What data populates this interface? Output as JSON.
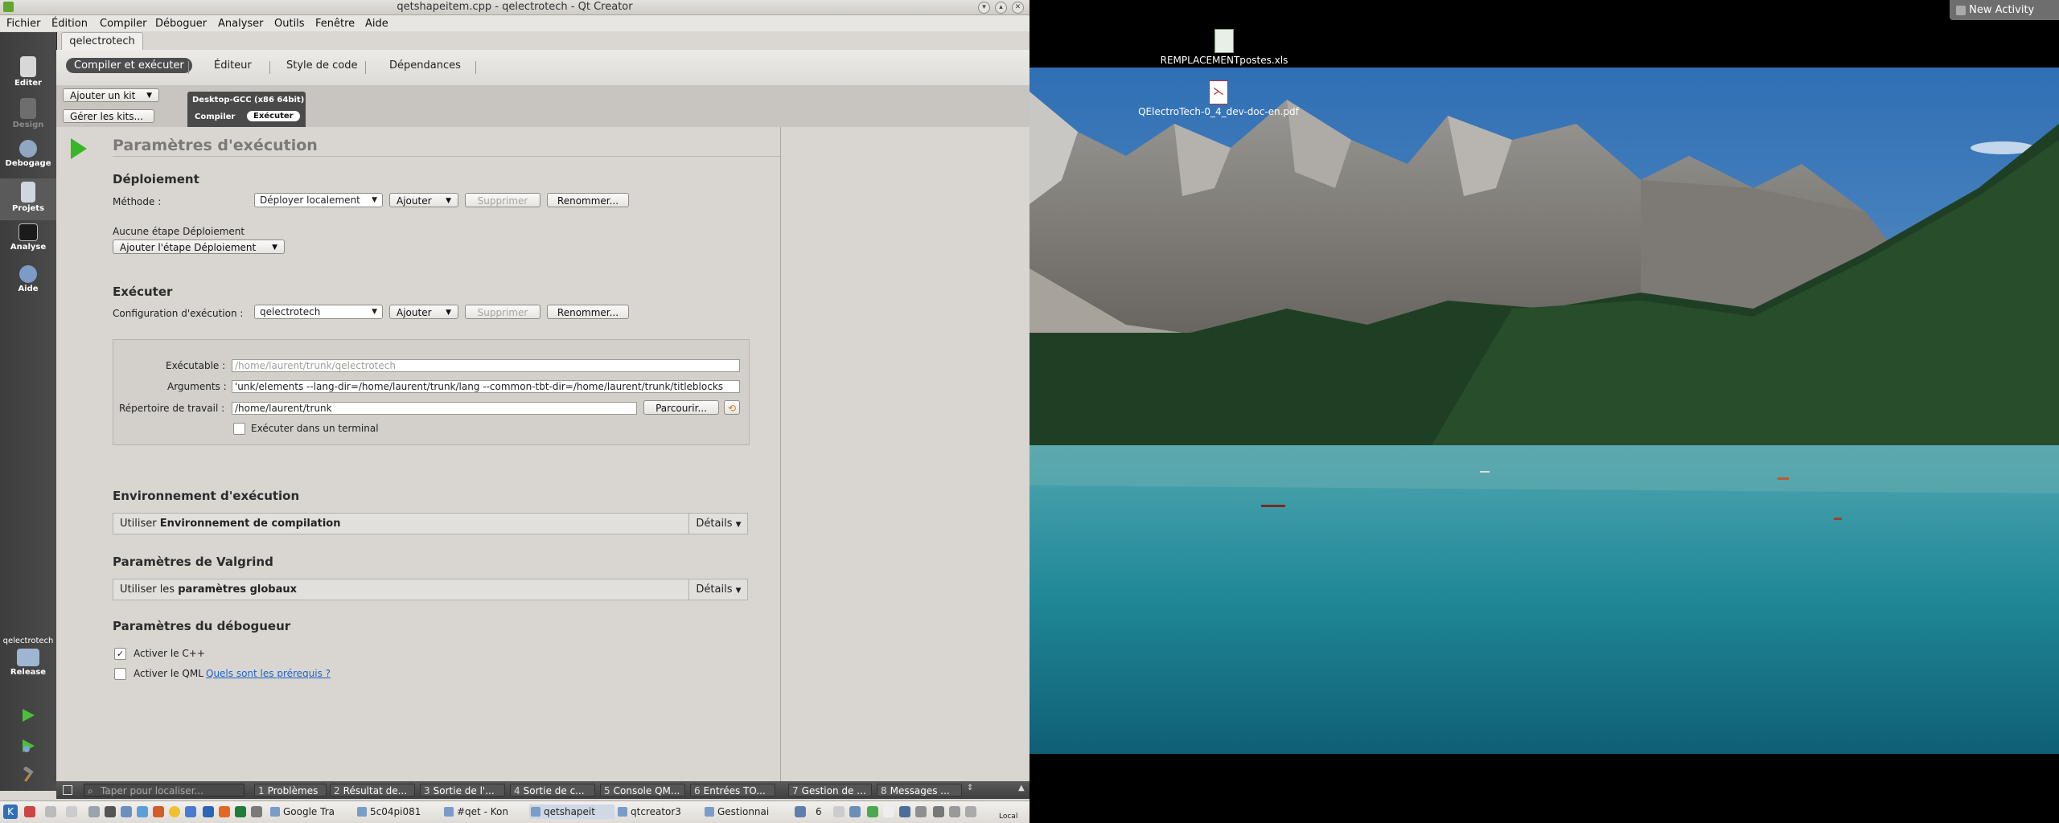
{
  "window": {
    "title": "qetshapeitem.cpp - qelectrotech - Qt Creator"
  },
  "menu": [
    "Fichier",
    "Édition",
    "Compiler",
    "Déboguer",
    "Analyser",
    "Outils",
    "Fenêtre",
    "Aide"
  ],
  "modes": {
    "edit": "Editer",
    "design": "Design",
    "debug": "Debogage",
    "projects": "Projets",
    "analyze": "Analyse",
    "help": "Aide"
  },
  "target": {
    "project": "qelectrotech",
    "config": "Release"
  },
  "doc_tab": "qelectrotech",
  "project_tabs": [
    "Compiler et exécuter",
    "Éditeur",
    "Style de code",
    "Dépendances"
  ],
  "kits": {
    "add_kit": "Ajouter un kit",
    "manage_kits": "Gérer les kits...",
    "kit_name": "Desktop-GCC (x86 64bit)",
    "build_tab": "Compiler",
    "run_tab": "Exécuter"
  },
  "run_settings": {
    "title": "Paramètres d'exécution",
    "deploy": {
      "heading": "Déploiement",
      "method_label": "Méthode :",
      "method_value": "Déployer localement",
      "add": "Ajouter",
      "remove": "Supprimer",
      "rename": "Renommer...",
      "no_step": "Aucune étape Déploiement",
      "add_step": "Ajouter l'étape Déploiement"
    },
    "run": {
      "heading": "Exécuter",
      "config_label": "Configuration d'exécution :",
      "config_value": "qelectrotech",
      "add": "Ajouter",
      "remove": "Supprimer",
      "rename": "Renommer...",
      "exe_label": "Exécutable :",
      "exe_value": "/home/laurent/trunk/qelectrotech",
      "args_label": "Arguments :",
      "args_value": "'unk/elements --lang-dir=/home/laurent/trunk/lang  --common-tbt-dir=/home/laurent/trunk/titleblocks",
      "workdir_label": "Répertoire de travail :",
      "workdir_value": "/home/laurent/trunk",
      "browse": "Parcourir...",
      "terminal": "Exécuter dans un terminal"
    },
    "env": {
      "heading": "Environnement d'exécution",
      "use": "Utiliser",
      "value": "Environnement de compilation",
      "details": "Détails"
    },
    "valgrind": {
      "heading": "Paramètres de Valgrind",
      "use": "Utiliser les",
      "value": "paramètres globaux",
      "details": "Détails"
    },
    "debugger": {
      "heading": "Paramètres du débogueur",
      "cpp": "Activer le C++",
      "qml": "Activer le QML",
      "prereq_link": "Quels sont les prérequis ?"
    }
  },
  "output_bar": {
    "search_placeholder": "Taper pour localiser...",
    "panes": [
      {
        "num": "1",
        "label": "Problèmes"
      },
      {
        "num": "2",
        "label": "Résultat de..."
      },
      {
        "num": "3",
        "label": "Sortie de l'..."
      },
      {
        "num": "4",
        "label": "Sortie de c..."
      },
      {
        "num": "5",
        "label": "Console QM..."
      },
      {
        "num": "6",
        "label": "Entrées TO..."
      },
      {
        "num": "7",
        "label": "Gestion de ..."
      },
      {
        "num": "8",
        "label": "Messages ..."
      }
    ]
  },
  "taskbar": {
    "tasks": [
      "Google Tra",
      "5c04pi081",
      "#qet - Kon",
      "qetshapeit",
      "qtcreator3",
      "Gestionnai"
    ],
    "desktop_num": "6",
    "clock": "Local"
  },
  "desktop": {
    "new_activity": "New Activity",
    "icons": [
      "REMPLACEMENTpostes.xls",
      "QElectroTech-0_4_dev-doc-en.pdf"
    ]
  }
}
